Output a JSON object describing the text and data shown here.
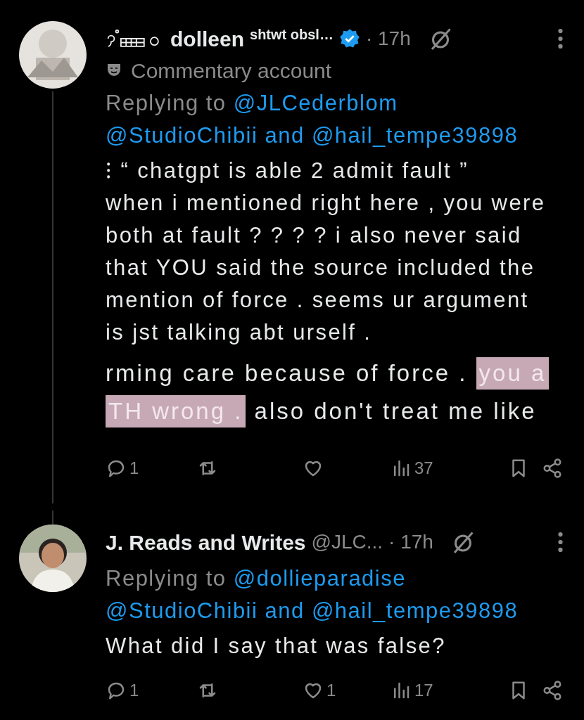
{
  "tweets": [
    {
      "name": "dolleen",
      "name_suffix": "shtwt obsl…",
      "verified": true,
      "time": "· 17h",
      "label": "Commentary account",
      "replying_prefix": "Replying to ",
      "replying_to": [
        "@JLCederblom",
        "@StudioChibii",
        "and",
        "@hail_tempe39898"
      ],
      "text": "⁝ “ chatgpt is able 2 admit fault ”\nwhen i mentioned right here , you were\nboth at fault ? ? ? ? i also never said\nthat YOU said the source included the\nmention of force . seems ur argument\nis jst talking abt urself .",
      "image_lines": [
        [
          {
            "text": "rming care because of force . ",
            "highlighted": false
          },
          {
            "text": "you a",
            "highlighted": true
          }
        ],
        [
          {
            "text": "TH wrong .",
            "highlighted": true
          },
          {
            "text": " also don't treat me like",
            "highlighted": false
          }
        ]
      ],
      "actions": {
        "replies": "1",
        "views": "37"
      }
    },
    {
      "name": "J. Reads and Writes",
      "verified": false,
      "handle": "@JLC...",
      "time": "· 17h",
      "replying_prefix": "Replying to ",
      "replying_to": [
        "@dollieparadise",
        "@StudioChibii",
        "and",
        "@hail_tempe39898"
      ],
      "text": "What did I say that was false?",
      "actions": {
        "replies": "1",
        "likes": "1",
        "views": "17"
      }
    }
  ]
}
